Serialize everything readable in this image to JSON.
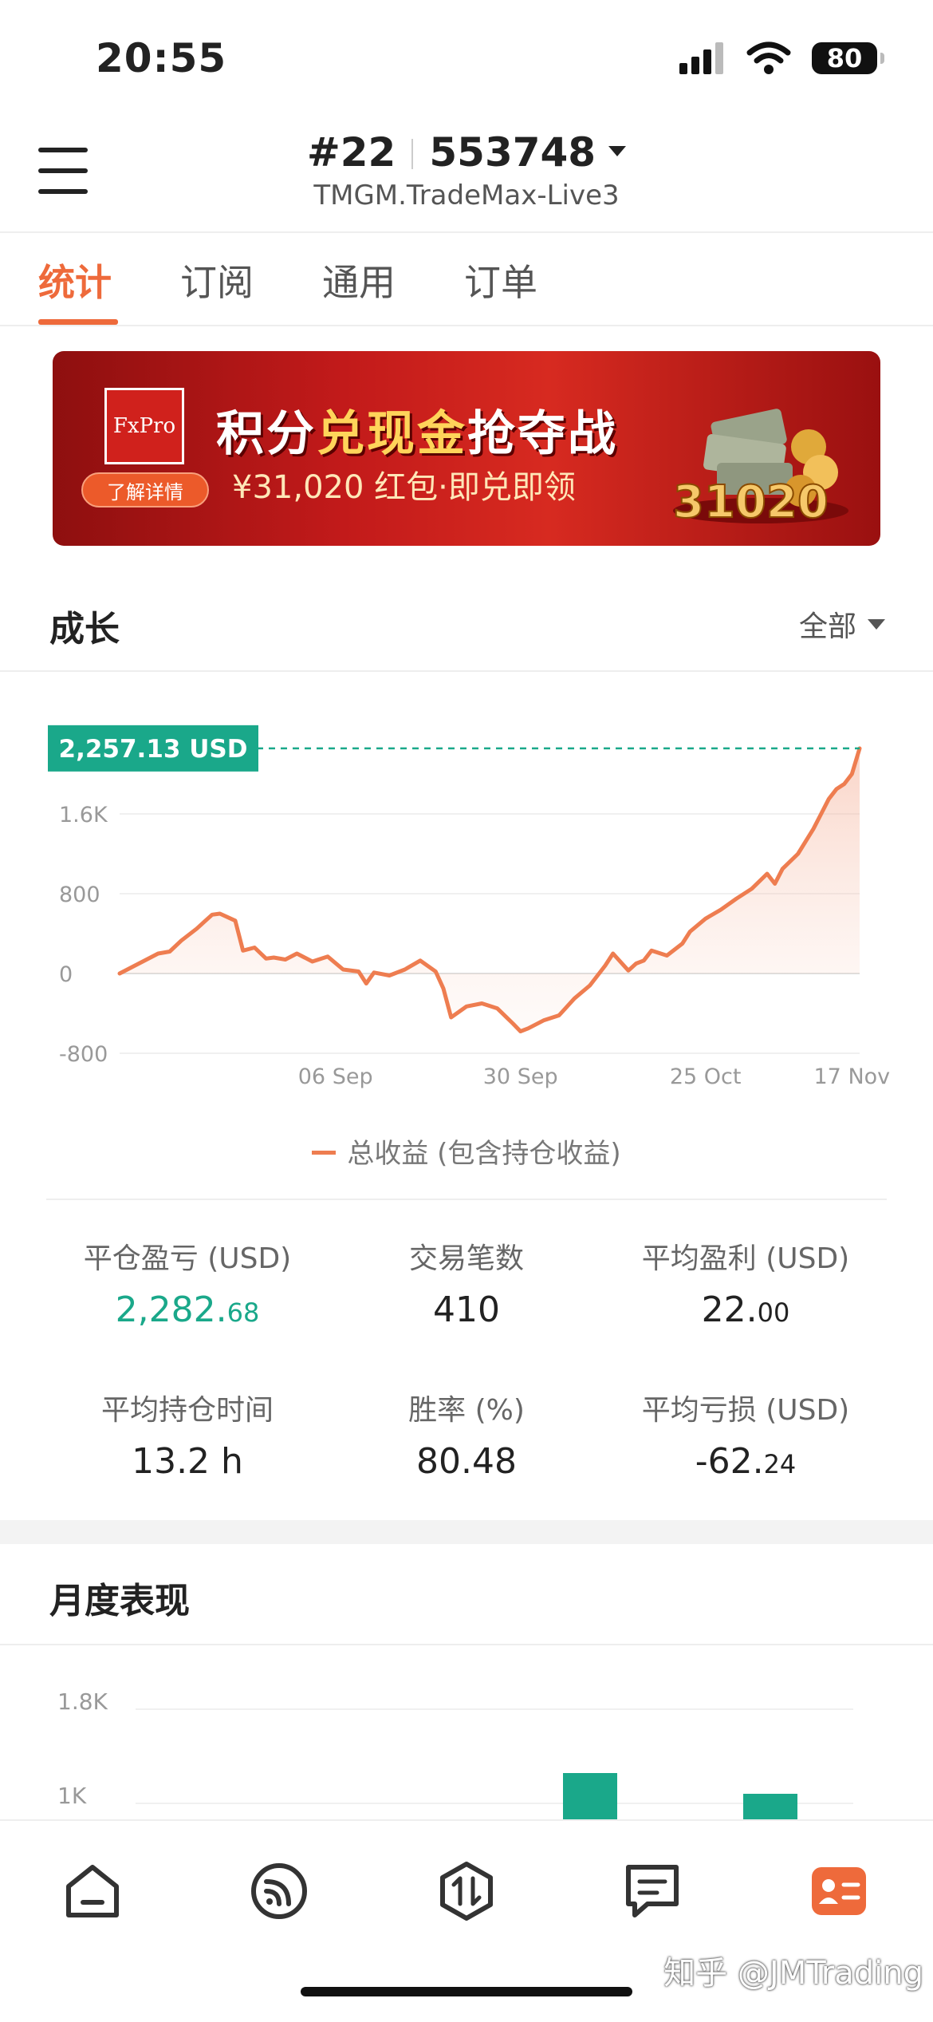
{
  "status_bar": {
    "time": "20:55",
    "battery": "80"
  },
  "header": {
    "account_prefix": "#22",
    "account_number": "553748",
    "server": "TMGM.TradeMax-Live3"
  },
  "tabs": [
    {
      "label": "统计",
      "active": true
    },
    {
      "label": "订阅",
      "active": false
    },
    {
      "label": "通用",
      "active": false
    },
    {
      "label": "订单",
      "active": false
    }
  ],
  "banner": {
    "logo": "FxPro",
    "title_a": "积分",
    "title_b": "兑现金",
    "title_c": "抢夺战",
    "subtitle": "¥31,020 红包·即兑即领",
    "learn_more": "了解详情",
    "amount_art": "31020"
  },
  "growth": {
    "title": "成长",
    "filter": "全部",
    "current_value_label": "2,257.13 USD",
    "legend": "总收益 (包含持仓收益)"
  },
  "chart_data": {
    "type": "area",
    "y_ticks": [
      -800,
      0,
      800,
      1600
    ],
    "y_tick_labels": [
      "-800",
      "0",
      "800",
      "1.6K"
    ],
    "ylim": [
      -900,
      2400
    ],
    "x_tick_labels": [
      "06 Sep",
      "30 Sep",
      "25 Oct",
      "17 Nov"
    ],
    "x_tick_positions": [
      28,
      52,
      76,
      95
    ],
    "xlim": [
      0,
      96
    ],
    "series": [
      {
        "name": "总收益 (包含持仓收益)",
        "color": "#ee7d50",
        "x": [
          0,
          3,
          5,
          6.5,
          8,
          10,
          12,
          13,
          15,
          16,
          17.5,
          19,
          20,
          21.5,
          23,
          25,
          27,
          29,
          31,
          32,
          33,
          35,
          37,
          39,
          41,
          42,
          43,
          45,
          47,
          49,
          51,
          52,
          53,
          55,
          57,
          59,
          61,
          63,
          64,
          66,
          67,
          68,
          69,
          71,
          73,
          74,
          76,
          78,
          80,
          82,
          84,
          85,
          86,
          88,
          90,
          91,
          92,
          93,
          94,
          95,
          96
        ],
        "y": [
          0,
          120,
          200,
          220,
          330,
          450,
          590,
          600,
          530,
          230,
          260,
          150,
          160,
          140,
          200,
          120,
          170,
          40,
          20,
          -100,
          10,
          -20,
          40,
          130,
          20,
          -150,
          -440,
          -330,
          -300,
          -350,
          -500,
          -580,
          -550,
          -470,
          -420,
          -250,
          -120,
          80,
          200,
          30,
          100,
          130,
          230,
          180,
          300,
          420,
          550,
          640,
          750,
          850,
          1000,
          900,
          1050,
          1200,
          1450,
          1600,
          1750,
          1850,
          1900,
          2000,
          2257
        ]
      }
    ],
    "grid": true,
    "reference_line": 2257.13
  },
  "stats": [
    {
      "label": "平仓盈亏 (USD)",
      "value_int": "2,282.",
      "value_dec": "68",
      "highlight": true
    },
    {
      "label": "交易笔数",
      "value_int": "410",
      "value_dec": "",
      "highlight": false
    },
    {
      "label": "平均盈利 (USD)",
      "value_int": "22.",
      "value_dec": "00",
      "highlight": false
    },
    {
      "label": "平均持仓时间",
      "value_int": "13.2 h",
      "value_dec": "",
      "highlight": false
    },
    {
      "label": "胜率 (%)",
      "value_int": "80.48",
      "value_dec": "",
      "highlight": false
    },
    {
      "label": "平均亏损 (USD)",
      "value_int": "-62.",
      "value_dec": "24",
      "highlight": false
    }
  ],
  "monthly": {
    "title": "月度表现",
    "y_tick_labels": [
      "1.8K",
      "1K"
    ],
    "bar_color": "#1aa88a"
  },
  "nav": [
    {
      "icon": "home-icon"
    },
    {
      "icon": "signal-icon"
    },
    {
      "icon": "trade-icon"
    },
    {
      "icon": "chat-icon"
    },
    {
      "icon": "profile-card-icon",
      "active": true
    }
  ],
  "watermark": "知乎 @JMTrading"
}
